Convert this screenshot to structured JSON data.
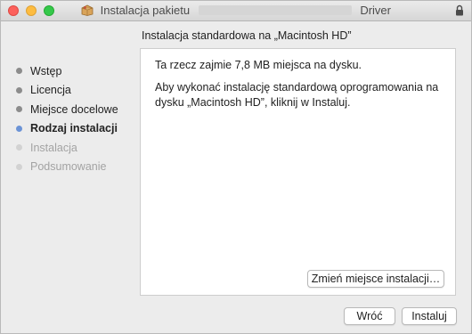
{
  "window": {
    "title_prefix": "Instalacja pakietu",
    "title_suffix": "Driver"
  },
  "heading": "Instalacja standardowa na „Macintosh HD”",
  "steps": [
    {
      "label": "Wstęp",
      "state": "done"
    },
    {
      "label": "Licencja",
      "state": "done"
    },
    {
      "label": "Miejsce docelowe",
      "state": "done"
    },
    {
      "label": "Rodzaj instalacji",
      "state": "current"
    },
    {
      "label": "Instalacja",
      "state": "future"
    },
    {
      "label": "Podsumowanie",
      "state": "future"
    }
  ],
  "content": {
    "size_text": "Ta rzecz zajmie 7,8 MB miejsca na dysku.",
    "instruction_text": "Aby wykonać instalację standardową oprogramowania na dysku „Macintosh HD”, kliknij w Instaluj."
  },
  "buttons": {
    "change_location": "Zmień miejsce instalacji…",
    "back": "Wróć",
    "install": "Instaluj"
  },
  "colors": {
    "current_step_dot": "#6b93d6",
    "close": "#fc605b",
    "minimize": "#fdbc40",
    "maximize": "#34c84a"
  },
  "icons": {
    "title_icon": "package-icon",
    "lock_icon": "lock-icon"
  }
}
